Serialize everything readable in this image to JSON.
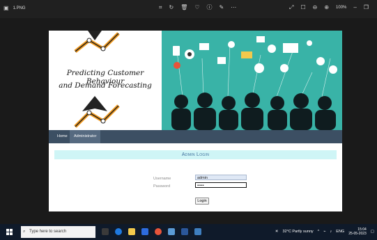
{
  "viewer": {
    "file_name": "1.PNG",
    "zoom": "100%",
    "icons": [
      "crop-icon",
      "rotate-icon",
      "delete-icon",
      "favorite-icon",
      "info-icon",
      "edit-icon",
      "more-icon"
    ],
    "right_icons": [
      "expand-icon",
      "fit-icon",
      "zoom-out-icon",
      "zoom-in-icon"
    ]
  },
  "page": {
    "banner": {
      "title_line1": "Predicting Customer Behaviour",
      "title_line2": "and Demand Forecasting",
      "right_bg": "#39b3a7"
    },
    "nav": {
      "items": [
        {
          "label": "Home"
        },
        {
          "label": "Administrator"
        }
      ]
    },
    "login": {
      "title": "Admin Login",
      "username_label": "Username",
      "password_label": "Password",
      "username_value": "admin",
      "password_value": "•••••",
      "button_label": "Login"
    }
  },
  "taskbar": {
    "search_placeholder": "Type here to search",
    "weather": "32°C Partly sunny",
    "language": "ENG",
    "time": "15:04",
    "date": "25-05-2023"
  }
}
